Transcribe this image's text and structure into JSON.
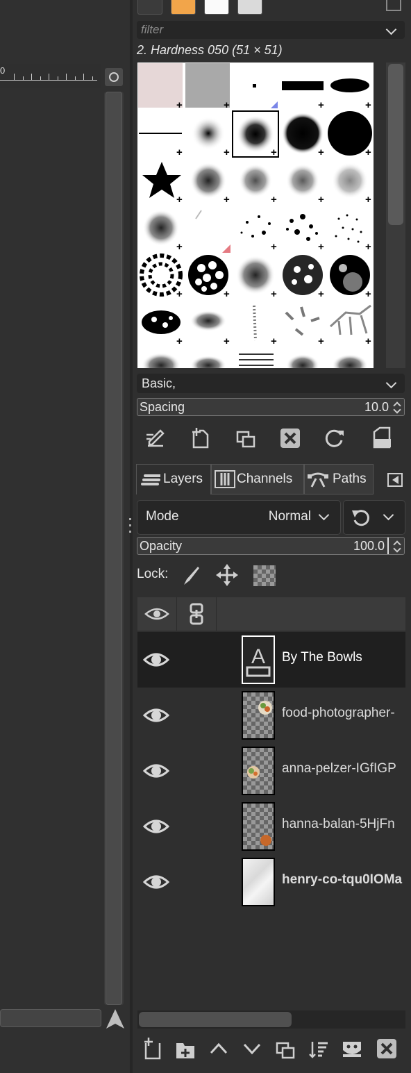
{
  "brushes": {
    "filter_placeholder": "filter",
    "current_brush": "2. Hardness 050 (51 × 51)",
    "tag_filter": "Basic,",
    "spacing_label": "Spacing",
    "spacing_value": "10.0",
    "tools": [
      "edit-brush-icon",
      "new-brush-icon",
      "duplicate-brush-icon",
      "delete-brush-icon",
      "refresh-brushes-icon",
      "open-brush-as-image-icon"
    ]
  },
  "layers_dock": {
    "tabs": [
      {
        "label": "Layers",
        "icon": "layers-icon",
        "active": true
      },
      {
        "label": "Channels",
        "icon": "channels-icon",
        "active": false
      },
      {
        "label": "Paths",
        "icon": "paths-icon",
        "active": false
      }
    ],
    "mode_label": "Mode",
    "mode_value": "Normal",
    "opacity_label": "Opacity",
    "opacity_value": "100.0",
    "lock_label": "Lock:",
    "layers": [
      {
        "name": "By The Bowls",
        "type": "text",
        "visible": true,
        "selected": true
      },
      {
        "name": "food-photographer-",
        "type": "image",
        "visible": true,
        "selected": false
      },
      {
        "name": "anna-pelzer-IGfIGP",
        "type": "image",
        "visible": true,
        "selected": false
      },
      {
        "name": "hanna-balan-5HjFn",
        "type": "image",
        "visible": true,
        "selected": false
      },
      {
        "name": "henry-co-tqu0IOMa",
        "type": "image",
        "visible": true,
        "selected": false
      }
    ]
  },
  "ruler": {
    "origin_label": "0"
  }
}
